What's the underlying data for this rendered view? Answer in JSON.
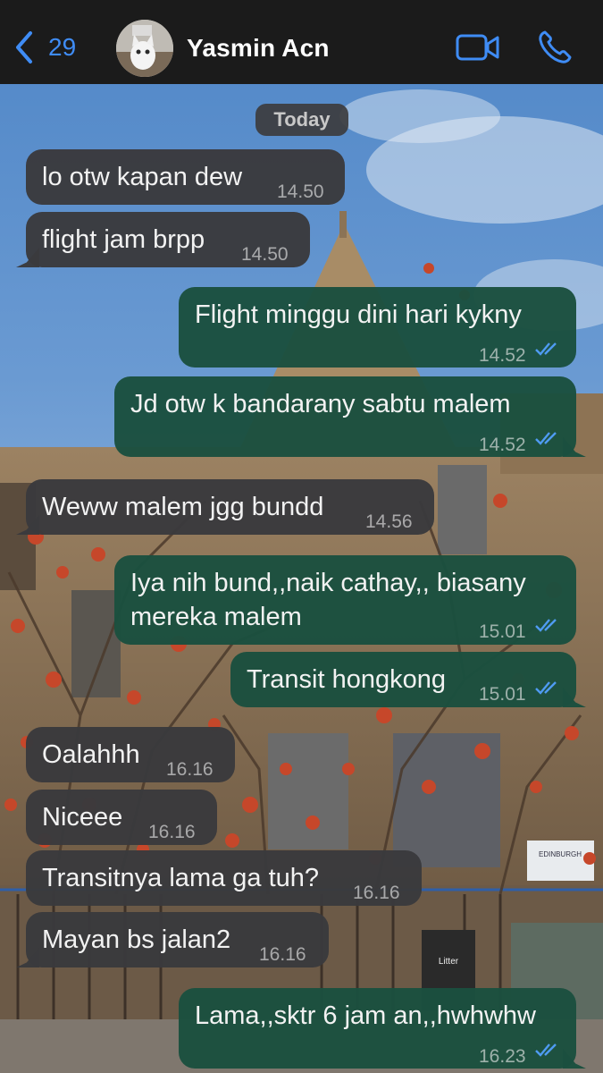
{
  "header": {
    "back_count": "29",
    "contact_name": "Yasmin Acn",
    "icons": {
      "back": "chevron-left-icon",
      "video": "video-camera-icon",
      "call": "phone-icon"
    },
    "accent_color": "#3f8cf5"
  },
  "chat": {
    "date_label": "Today",
    "messages": [
      {
        "direction": "received",
        "text": "lo otw kapan dew",
        "time": "14.50"
      },
      {
        "direction": "received",
        "text": "flight jam brpp",
        "time": "14.50"
      },
      {
        "direction": "sent",
        "text": "Flight minggu dini hari kykny",
        "time": "14.52",
        "status": "read"
      },
      {
        "direction": "sent",
        "text": "Jd otw k bandarany sabtu malem",
        "time": "14.52",
        "status": "read"
      },
      {
        "direction": "received",
        "text": "Weww malem jgg bundd",
        "time": "14.56"
      },
      {
        "direction": "sent",
        "text": "Iya nih bund,,naik cathay,, biasany mereka malem",
        "time": "15.01",
        "status": "read"
      },
      {
        "direction": "sent",
        "text": "Transit hongkong",
        "time": "15.01",
        "status": "read"
      },
      {
        "direction": "received",
        "text": "Oalahhh",
        "time": "16.16"
      },
      {
        "direction": "received",
        "text": "Niceee",
        "time": "16.16"
      },
      {
        "direction": "received",
        "text": "Transitnya lama ga tuh?",
        "time": "16.16"
      },
      {
        "direction": "received",
        "text": "Mayan bs jalan2",
        "time": "16.16"
      },
      {
        "direction": "sent",
        "text": "Lama,,sktr 6 jam an,,hwhwhw",
        "time": "16.23",
        "status": "read"
      }
    ],
    "colors": {
      "received_bubble": "#3a3a3d",
      "sent_bubble": "#1b503f",
      "read_ticks": "#4f9bf2"
    }
  },
  "background": {
    "wallpaper_sign_text": "EDINBURGH",
    "bin_label": "Litter"
  }
}
